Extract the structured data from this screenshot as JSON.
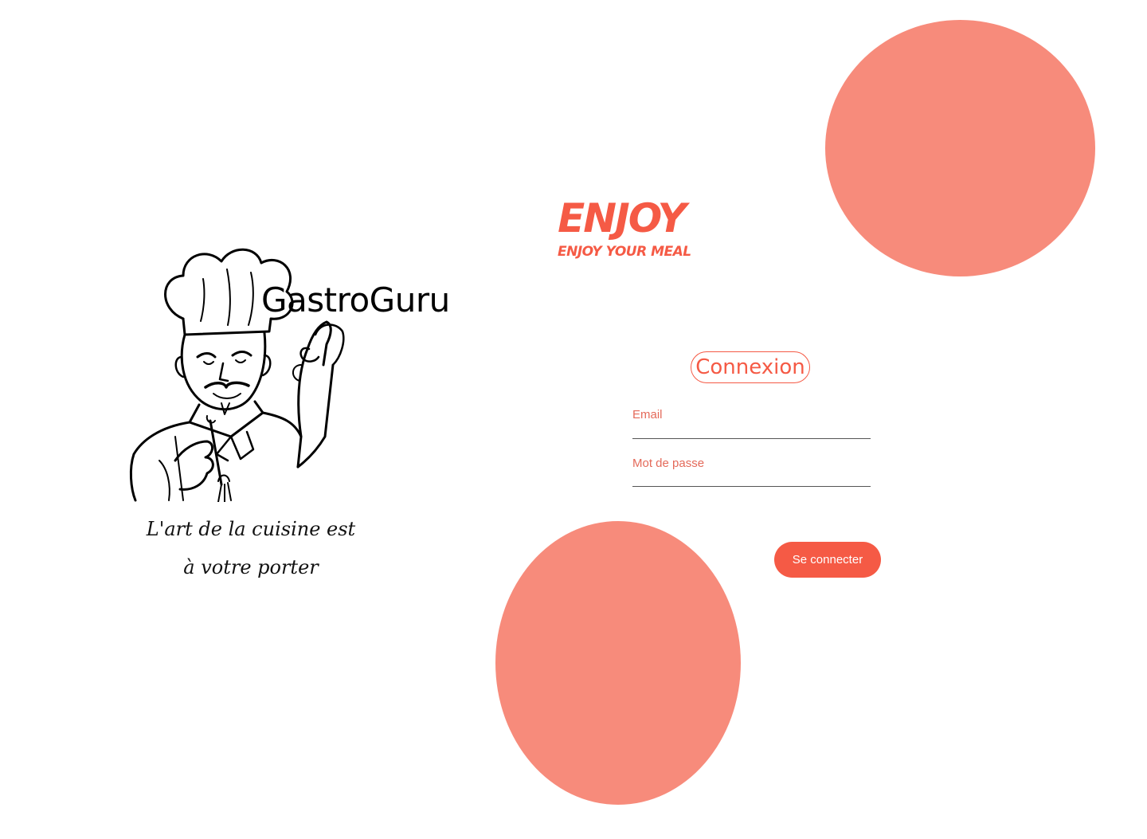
{
  "colors": {
    "accent": "#f55a45",
    "blob": "#f78b7b",
    "input_line": "#555555"
  },
  "brand": {
    "name": "GastroGuru",
    "slogan_line1": "L'art de la cuisine est",
    "slogan_line2": "à votre porter",
    "illustration_icon": "chef-icon"
  },
  "hero": {
    "title": "ENJOY",
    "subtitle": "ENJOY YOUR MEAL"
  },
  "login": {
    "title": "Connexion",
    "email_placeholder": "Email",
    "password_placeholder": "Mot de passe",
    "submit_label": "Se connecter"
  }
}
